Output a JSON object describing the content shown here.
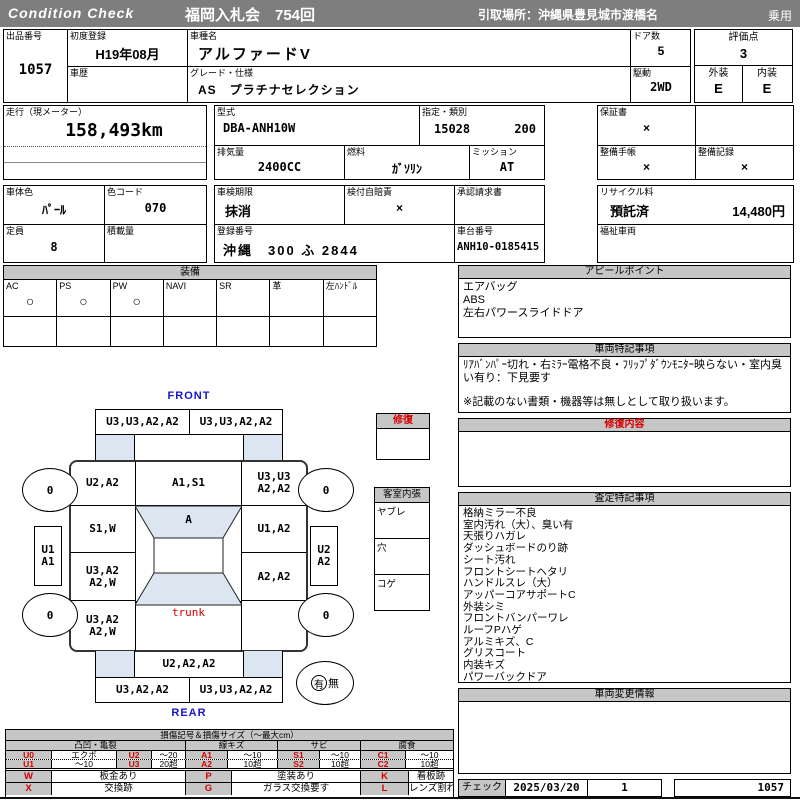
{
  "colors": {
    "topbar": "#7e7e7e",
    "section_header": "#c6c6c6",
    "accent_red": "#d40000",
    "accent_blue": "#1515cc",
    "diagram_blue": "#dce6f1"
  },
  "topbar": {
    "brand": "Condition Check",
    "auction": "福岡入札会　754回",
    "pickup": "引取場所：沖縄県豊見城市渡橋名",
    "category": "乗用"
  },
  "info": {
    "lot_label": "出品番号",
    "lot_no": "1057",
    "first_reg_label": "初度登録",
    "first_reg": "H19年08月",
    "model_label": "車種名",
    "model": "アルファードV",
    "history_label": "車歴",
    "history": "",
    "grade_label": "グレード・仕様",
    "grade": "AS　プラチナセレクション",
    "doors_label": "ドア数",
    "doors": "5",
    "drive_label": "駆動",
    "drive": "2WD",
    "score_label": "評価点",
    "score": "3",
    "exterior_label": "外装",
    "exterior": "E",
    "interior_label": "内装",
    "interior": "E"
  },
  "specs": {
    "mileage_label": "走行（現メーター）",
    "mileage": "158,493km",
    "model_code_label": "型式",
    "model_code": "DBA-ANH10W",
    "class_label": "指定・類別",
    "class_no1": "15028",
    "class_no2": "200",
    "displacement_label": "排気量",
    "displacement": "2400CC",
    "fuel_label": "燃料",
    "fuel": "ｶﾞｿﾘﾝ",
    "transmission_label": "ミッション",
    "transmission": "AT",
    "warranty_label": "保証書",
    "warranty": "×",
    "maintenance_book_label": "整備手帳",
    "maintenance_book": "×",
    "maintenance_record_label": "整備記録",
    "maintenance_record": "×",
    "body_color_label": "車体色",
    "body_color": "ﾊﾟｰﾙ",
    "color_code_label": "色コード",
    "color_code": "070",
    "capacity_label": "定員",
    "capacity": "8",
    "load_label": "積載量",
    "load": "",
    "inspection_label": "車検期限",
    "inspection": "抹消",
    "insurance_label": "検付自賠責",
    "insurance": "×",
    "approval_label": "承認請求書",
    "approval": "",
    "recycle_label": "リサイクル料",
    "recycle_status": "預託済",
    "recycle_fee": "14,480円",
    "reg_no_label": "登録番号",
    "reg_no": "沖縄　300 ふ 2844",
    "chassis_label": "車台番号",
    "chassis_no": "ANH10-0185415",
    "welfare_label": "福祉車両",
    "welfare": ""
  },
  "equipment": {
    "title": "装備",
    "items": [
      {
        "label": "AC",
        "mark": "○"
      },
      {
        "label": "PS",
        "mark": "○"
      },
      {
        "label": "PW",
        "mark": "○"
      },
      {
        "label": "NAVI",
        "mark": ""
      },
      {
        "label": "SR",
        "mark": ""
      },
      {
        "label": "革",
        "mark": ""
      },
      {
        "label": "左ﾊﾝﾄﾞﾙ",
        "mark": ""
      }
    ]
  },
  "appeal": {
    "title": "アピールポイント",
    "lines": [
      "エアバッグ",
      "ABS",
      "左右パワースライドドア"
    ]
  },
  "notes": {
    "title": "車両特記事項",
    "text": "ﾘｱﾊﾞﾝﾊﾟｰ切れ・右ﾐﾗｰ電格不良・ﾌﾘｯﾌﾟﾀﾞｳﾝﾓﾆﾀｰ映らない・室内臭い有り：下見要す",
    "disclaimer": "※記載のない書類・機器等は無しとして取り扱います。"
  },
  "repair": {
    "title": "修復内容",
    "content": ""
  },
  "assessment": {
    "title": "査定特記事項",
    "items": [
      "格納ミラー不良",
      "室内汚れ（大）、臭い有",
      "天張りハガレ",
      "ダッシュボードのり跡",
      "シート汚れ",
      "フロントシートヘタリ",
      "ハンドルスレ（大）",
      "アッパーコアサポートC",
      "外装シミ",
      "フロントバンパーワレ",
      "ルーフPハゲ",
      "アルミキズ、C",
      "グリスコート",
      "内装キズ",
      "パワーバックドア"
    ]
  },
  "change_info": {
    "title": "車両変更情報",
    "content": ""
  },
  "check": {
    "label": "チェック",
    "date": "2025/03/20",
    "count": "1",
    "lot": "1057"
  },
  "diagram": {
    "front_label": "FRONT",
    "rear_label": "REAR",
    "trunk_label": "trunk",
    "repair_box_title": "修復",
    "interior_title": "客室内張",
    "interior_rows": [
      "ヤブレ",
      "穴",
      "コゲ"
    ],
    "presence_yes": "有",
    "presence_no": "無",
    "panels": {
      "front_bumper_left": "U3,U3,A2,A2",
      "front_bumper_right": "U3,U3,A2,A2",
      "fender_front_left": "U2,A2",
      "hood": "A1,S1",
      "fender_front_right": "U3,U3\nA2,A2",
      "door_front_left": "S1,W",
      "windshield": "A",
      "door_front_right": "U1,A2",
      "door_rear_left": "U3,A2\nA2,W",
      "door_rear_right": "A2,A2",
      "quarter_left": "U3,A2\nA2,W",
      "quarter_right": "",
      "rear_gate": "U2,A2,A2",
      "rear_bumper_left": "U3,A2,A2",
      "rear_bumper_right": "U3,U3,A2,A2",
      "wheel_front_left": "0",
      "wheel_front_right": "0",
      "wheel_rear_left": "0",
      "wheel_rear_right": "0",
      "step_left": "U1\nA1",
      "step_right": "U2\nA2"
    }
  },
  "legend": {
    "title": "損傷記号＆損傷サイズ（～最大cm）",
    "groups": [
      "凸凹・亀裂",
      "線キズ",
      "サビ",
      "腐食"
    ],
    "rows": [
      [
        "U0",
        "エクボ",
        "U2",
        "～20",
        "A1",
        "～10",
        "S1",
        "～10",
        "C1",
        "～10"
      ],
      [
        "U1",
        "～10",
        "U3",
        "20超",
        "A2",
        "10超",
        "S2",
        "10超",
        "C2",
        "10超"
      ]
    ],
    "marks": [
      [
        "W",
        "板金あり",
        "P",
        "塗装あり",
        "K",
        "看板跡"
      ],
      [
        "X",
        "交換跡",
        "G",
        "ガラス交換要す",
        "L",
        "レンズ割れ"
      ]
    ]
  }
}
